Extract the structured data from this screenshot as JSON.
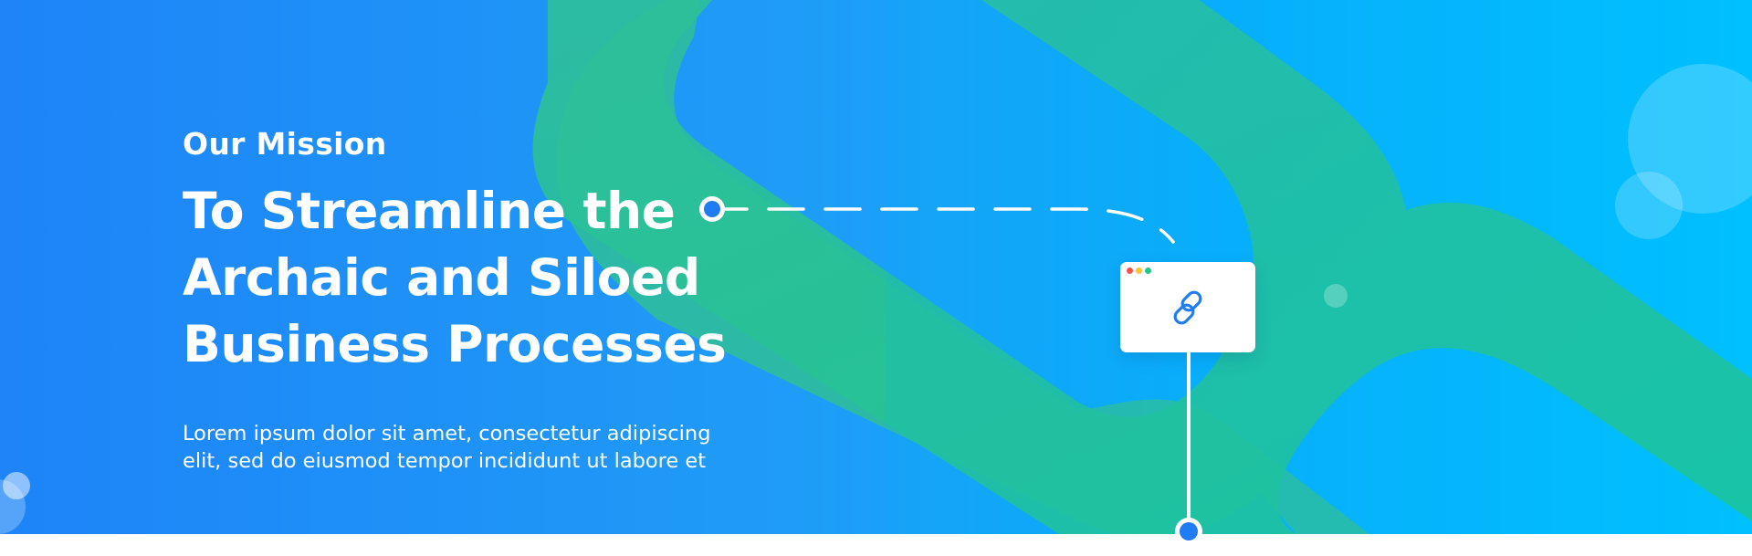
{
  "hero": {
    "eyebrow": "Our Mission",
    "headline_lines": [
      "To Streamline the",
      "Archaic and Siloed",
      "Business Processes"
    ],
    "body_lines": [
      "Lorem ipsum dolor sit amet, consectetur adipiscing",
      "elit, sed do eiusmod tempor incididunt ut labore et"
    ]
  },
  "illustration": {
    "card_icon": "link-icon",
    "window_dots": [
      "red-dot",
      "yellow-dot",
      "green-dot"
    ]
  },
  "colors": {
    "gradient_start": "#1e84f8",
    "gradient_end": "#00c2ff",
    "ribbon": "#26c08a",
    "node_blue": "#1f7cf2",
    "text": "#ffffff"
  }
}
